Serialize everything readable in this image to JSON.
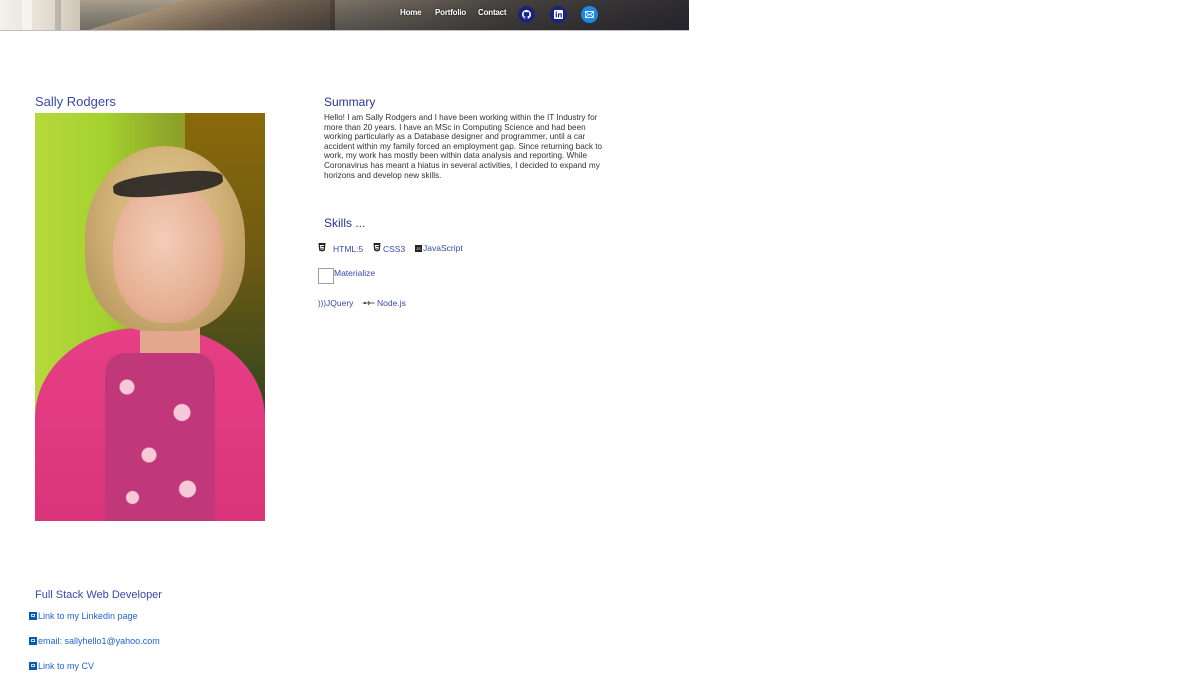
{
  "nav": {
    "home": "Home",
    "portfolio": "Portfolio",
    "contact": "Contact",
    "social": [
      "github-icon",
      "linkedin-icon",
      "email-icon"
    ]
  },
  "profile": {
    "name": "Sally Rodgers",
    "photo_alt": "profile photo"
  },
  "summary": {
    "title": "Summary",
    "text": "Hello! I am Sally Rodgers and I have been working within the IT Industry for more than 20 years. I have an MSc in Computing Science and had been working particularly as a Database designer and programmer, until a car accident within my family forced an employment gap. Since returning back to work, my work has mostly been within data analysis and reporting. While Coronavirus has meant a hiatus in several activities, I decided to expand my horizons and develop new skills."
  },
  "skills": {
    "title": "Skills ...",
    "items": [
      {
        "label": "HTML:5",
        "icon": "html5-icon"
      },
      {
        "label": "CSS3",
        "icon": "css3-icon"
      },
      {
        "label": "JavaScript",
        "icon": "javascript-icon"
      },
      {
        "label": "Materialize",
        "icon": "materialize-icon"
      },
      {
        "label": "JQuery",
        "icon": "jquery-icon"
      },
      {
        "label": "Node.js",
        "icon": "nodejs-icon"
      }
    ]
  },
  "footer": {
    "title": "Full Stack Web Developer",
    "linkedin": "Link to my Linkedin page",
    "email": "email: sallyhello1@yahoo.com",
    "cv": "Link to my CV"
  },
  "colors": {
    "accent": "#3949ab",
    "link": "#1e63d6",
    "social_bg": "#1a237e",
    "email_bg": "#1e88e5"
  }
}
